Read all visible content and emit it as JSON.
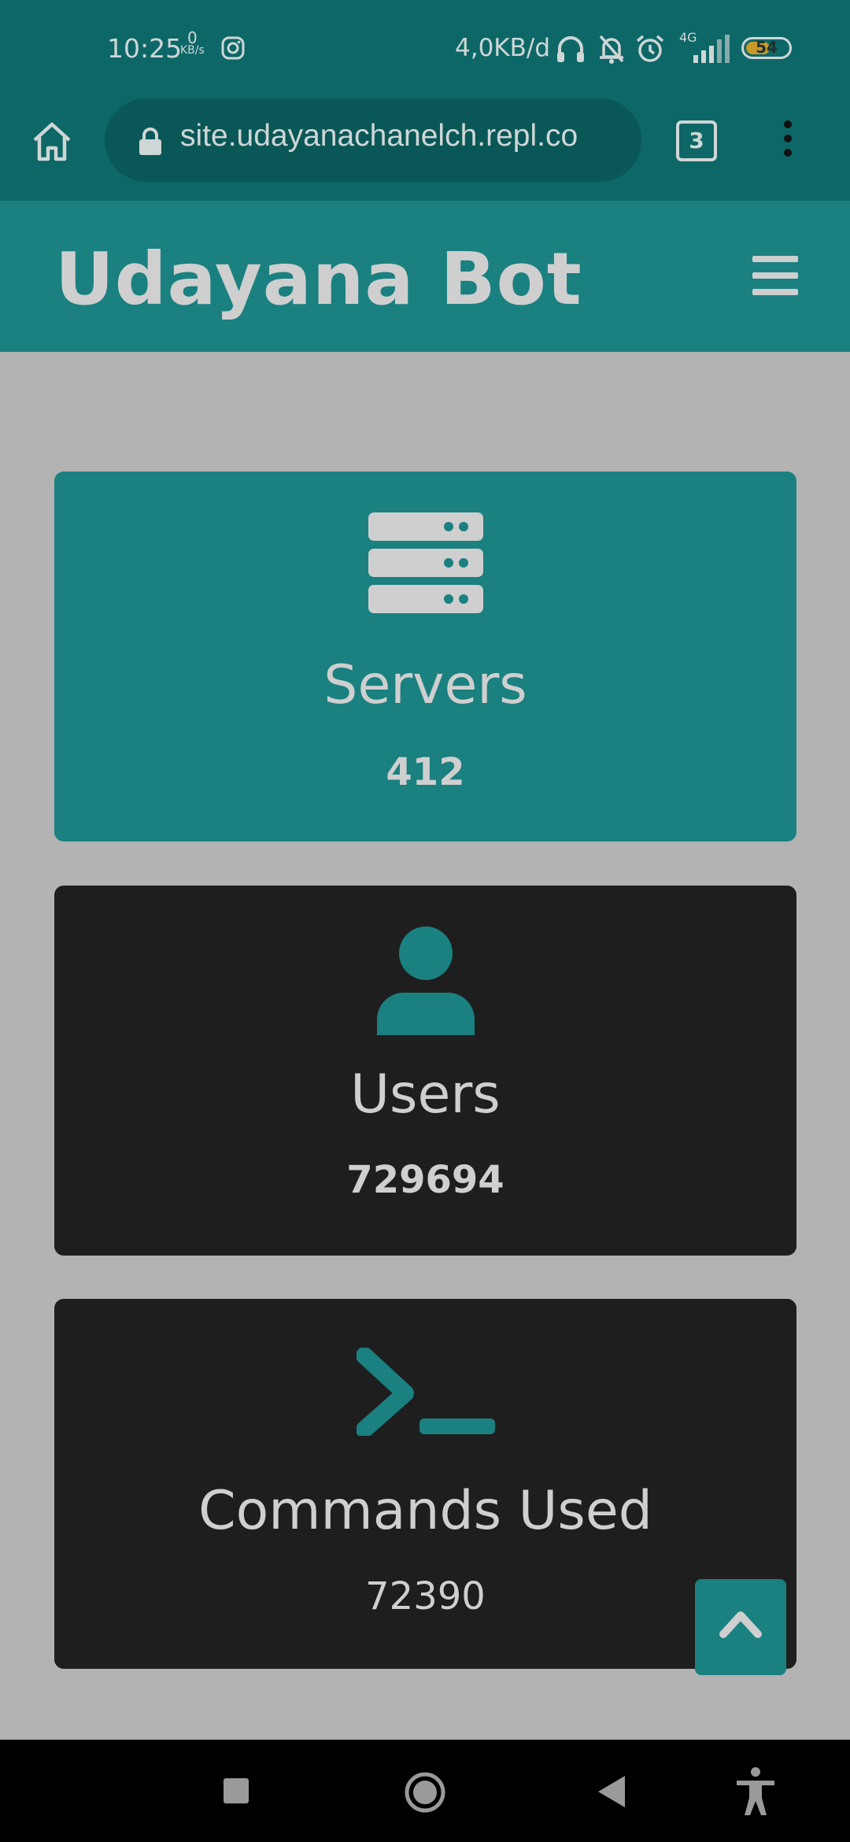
{
  "status_bar": {
    "time": "10:25",
    "net_value": "0",
    "net_unit": "KB/s",
    "data_usage": "4,0KB/d",
    "network": "4G",
    "battery": "54"
  },
  "browser": {
    "url": "site.udayanachanelch.repl.co",
    "tab_count": "3"
  },
  "site": {
    "brand": "Udayana Bot"
  },
  "stats": [
    {
      "label": "Servers",
      "value": "412"
    },
    {
      "label": "Users",
      "value": "729694"
    },
    {
      "label": "Commands Used",
      "value": "72390"
    }
  ],
  "colors": {
    "teal": "#1a8080",
    "dark_card": "#1e1e1e",
    "page_bg": "#b3b3b3",
    "status_bg": "#0d6767"
  }
}
